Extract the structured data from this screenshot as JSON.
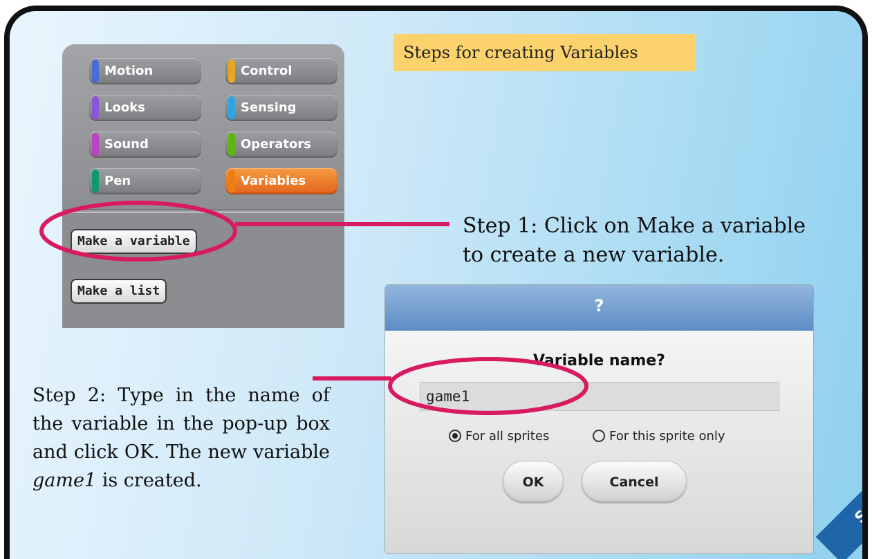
{
  "banner": {
    "title": "Steps for creating Variables"
  },
  "palette": {
    "categories": [
      {
        "label": "Motion",
        "color": "#4a6cd4"
      },
      {
        "label": "Control",
        "color": "#e6a822"
      },
      {
        "label": "Looks",
        "color": "#8a55d7"
      },
      {
        "label": "Sensing",
        "color": "#2ca5e2"
      },
      {
        "label": "Sound",
        "color": "#bb42c3"
      },
      {
        "label": "Operators",
        "color": "#5cb712"
      },
      {
        "label": "Pen",
        "color": "#0e9a6c"
      },
      {
        "label": "Variables",
        "color": "#ee7d16"
      }
    ],
    "active_category": "Variables",
    "make_variable_label": "Make a variable",
    "make_list_label": "Make a list"
  },
  "dialog": {
    "title": "?",
    "prompt": "Variable name?",
    "input_value": "game1",
    "radio_all_label": "For all sprites",
    "radio_this_label": "For this sprite only",
    "selected_scope": "For all sprites",
    "ok_label": "OK",
    "cancel_label": "Cancel"
  },
  "steps": {
    "step1": "Step 1: Click on Make a variable to create a new variable.",
    "step2_before": "Step 2: Type in the name of the variable in the pop-up box and click OK. The new variable ",
    "step2_em": "game1",
    "step2_after": " is created."
  },
  "ribbon": {
    "label": "SKILLS"
  },
  "colors": {
    "highlight_ring": "#d81b60",
    "banner": "#fbd26b",
    "ribbon": "#1f66a8",
    "dialog_title_bar": "#5d8cc5"
  }
}
